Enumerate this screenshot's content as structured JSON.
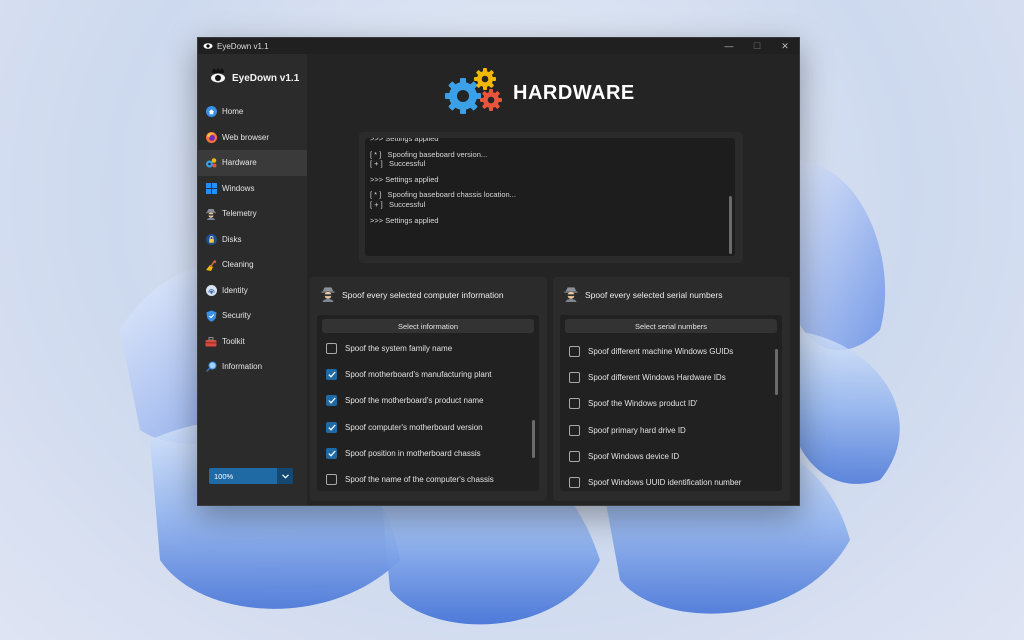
{
  "window": {
    "title": "EyeDown v1.1",
    "minimize": "—",
    "maximize": "☐",
    "close": "✕"
  },
  "app": {
    "name": "EyeDown v1.1"
  },
  "nav": [
    {
      "label": "Home",
      "icon": "home-icon"
    },
    {
      "label": "Web browser",
      "icon": "firefox-icon"
    },
    {
      "label": "Hardware",
      "icon": "gears-icon",
      "active": true
    },
    {
      "label": "Windows",
      "icon": "windows-logo-icon"
    },
    {
      "label": "Telemetry",
      "icon": "spy-icon"
    },
    {
      "label": "Disks",
      "icon": "lock-icon"
    },
    {
      "label": "Cleaning",
      "icon": "broom-icon"
    },
    {
      "label": "Identity",
      "icon": "fingerprint-icon"
    },
    {
      "label": "Security",
      "icon": "shield-icon"
    },
    {
      "label": "Toolkit",
      "icon": "toolbox-icon"
    },
    {
      "label": "Information",
      "icon": "magnifier-icon"
    }
  ],
  "zoom": {
    "value": "100%"
  },
  "page": {
    "title": "HARDWARE"
  },
  "console": {
    "lines": [
      ">>> Settings applied",
      "",
      "[ * ]   Spoofing baseboard version...",
      "[ + ]   Successful",
      "",
      ">>> Settings applied",
      "",
      "[ * ]   Spoofing baseboard chassis location...",
      "[ + ]   Successful",
      "",
      ">>> Settings applied"
    ]
  },
  "computer_panel": {
    "title": "Spoof every selected computer information",
    "select_label": "Select information",
    "options": [
      {
        "label": "Spoof the system family name",
        "checked": false
      },
      {
        "label": "Spoof motherboard's manufacturing plant",
        "checked": true
      },
      {
        "label": "Spoof the motherboard's product name",
        "checked": true
      },
      {
        "label": "Spoof computer's motherboard version",
        "checked": true
      },
      {
        "label": "Spoof position in motherboard chassis",
        "checked": true
      },
      {
        "label": "Spoof the name of the computer's chassis",
        "checked": false
      }
    ]
  },
  "serial_panel": {
    "title": "Spoof every selected serial numbers",
    "select_label": "Select serial numbers",
    "options": [
      {
        "label": "Spoof different machine Windows GUIDs",
        "checked": false
      },
      {
        "label": "Spoof different Windows Hardware IDs",
        "checked": false
      },
      {
        "label": "Spoof the Windows product ID'",
        "checked": false
      },
      {
        "label": "Spoof primary hard drive ID",
        "checked": false
      },
      {
        "label": "Spoof Windows device ID",
        "checked": false
      },
      {
        "label": "Spoof Windows UUID identification number",
        "checked": false
      }
    ]
  }
}
